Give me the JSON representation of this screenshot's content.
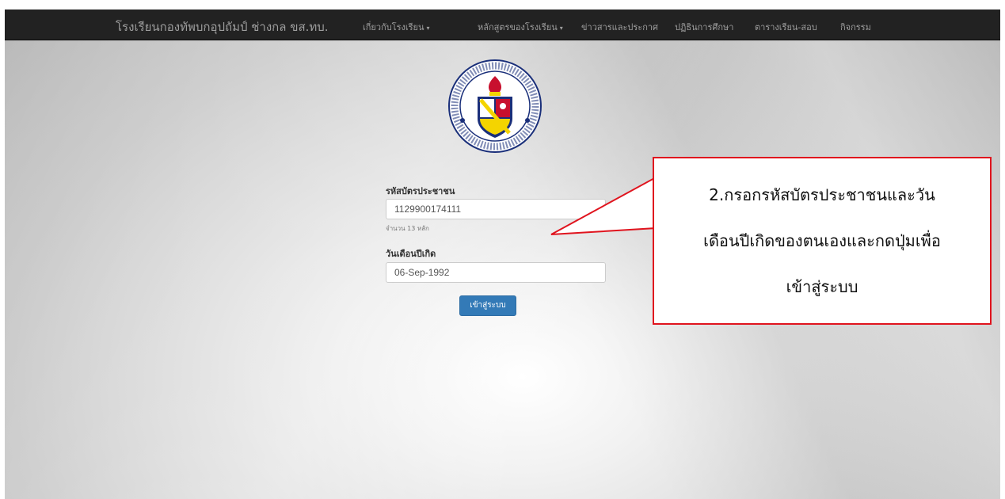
{
  "navbar": {
    "brand": "โรงเรียนกองทัพบกอุปถัมป์ ช่างกล ขส.ทบ.",
    "items": [
      {
        "label": "เกี่ยวกับโรงเรียน",
        "caret": "▾"
      },
      {
        "label": "หลักสูตรของโรงเรียน",
        "caret": "▾"
      },
      {
        "label": "ข่าวสารและประกาศ"
      },
      {
        "label": "ปฏิธินการศึกษา"
      },
      {
        "label": "ตารางเรียน-สอบ"
      },
      {
        "label": "กิจกรรม"
      }
    ]
  },
  "login_form": {
    "id_label": "รหัสบัตรประชาชน",
    "id_value": "1129900174111",
    "id_help": "จำนวน 13 หลัก",
    "dob_label": "วันเดือนปีเกิด",
    "dob_value": "06-Sep-1992",
    "submit_label": "เข้าสู่ระบบ"
  },
  "logo": {
    "icon": "school-crest-icon",
    "colors": {
      "ring": "#1a2f7a",
      "shield_red": "#c8102e",
      "shield_yellow": "#f4d400",
      "shield_blue": "#1a2f7a"
    }
  },
  "annotation": {
    "lines": [
      "2.กรอกรหัสบัตรประชาชนและวัน",
      "เดือนปีเกิดของตนเองและกดปุ่มเพื่อ",
      "เข้าสู่ระบบ"
    ],
    "border_color": "#e0141e"
  },
  "colors": {
    "navbar_bg": "#222222",
    "navbar_text": "#9d9d9d",
    "button_bg": "#337ab7"
  }
}
